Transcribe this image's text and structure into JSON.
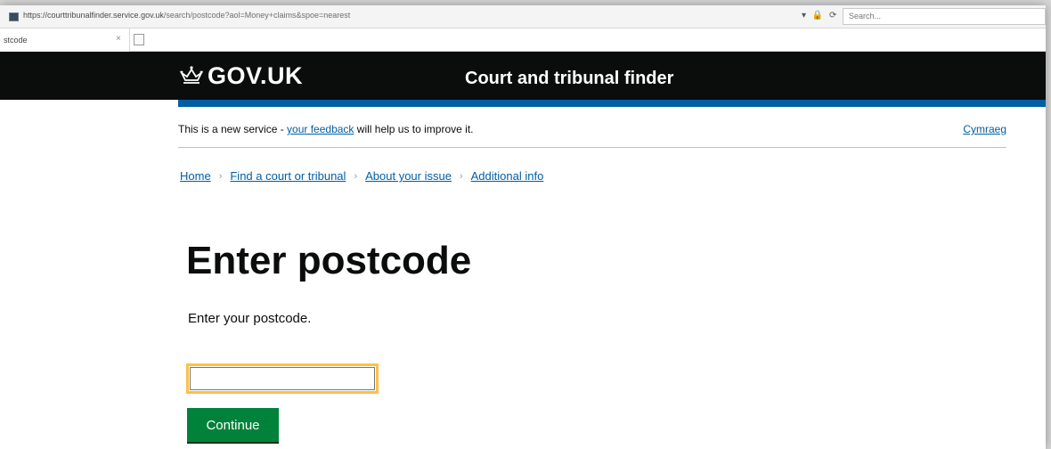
{
  "browser": {
    "url_host": "https://courttribunalfinder.service.gov.uk",
    "url_path": "/search/postcode?aol=Money+claims&spoe=nearest",
    "controls": "▾ 🔒 ⟳",
    "search_placeholder": "Search...",
    "tab_label": "stcode",
    "tab_close": "×"
  },
  "header": {
    "logo": "GOV.UK",
    "service_name": "Court and tribunal finder",
    "colors": {
      "background": "#0b0c0c",
      "accent": "#005ea5"
    }
  },
  "phase_banner": {
    "text_before": "This is a new service - ",
    "feedback_link": "your feedback",
    "text_after": " will help us to improve it.",
    "language_link": "Cymraeg"
  },
  "breadcrumb": {
    "items": [
      "Home",
      "Find a court or tribunal",
      "About your issue",
      "Additional info"
    ],
    "separator": "›"
  },
  "main": {
    "title": "Enter postcode",
    "hint": "Enter your postcode.",
    "input_value": "",
    "button_label": "Continue",
    "colors": {
      "button": "#00823b",
      "focus": "#ffbf47"
    }
  }
}
